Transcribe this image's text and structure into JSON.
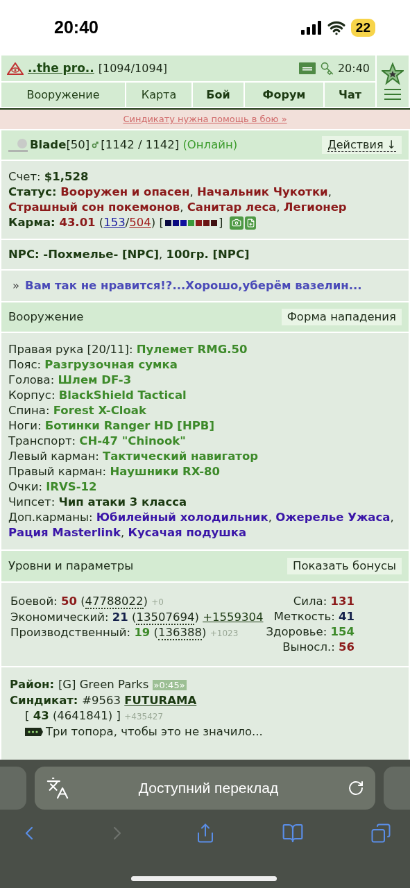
{
  "status_bar": {
    "time": "20:40",
    "battery": "22"
  },
  "header": {
    "nick": "..the pro..",
    "hp": "[1094/1094]",
    "time": "20:40"
  },
  "nav_tabs": [
    {
      "label": "Вооружение",
      "bold": false
    },
    {
      "label": "Карта",
      "bold": false
    },
    {
      "label": "Бой",
      "bold": true
    },
    {
      "label": "Форум",
      "bold": true
    },
    {
      "label": "Чат",
      "bold": true
    }
  ],
  "banner": "Синдикату нужна помощь в бою »",
  "player": {
    "name": [
      {
        "text": "Blade",
        "kind": "label"
      },
      {
        "text": "[50]",
        "kind": "plain"
      }
    ],
    "health": [
      {
        "text": "[1142 / 1142] ",
        "kind": "plain"
      },
      {
        "text": "(Онлайн)",
        "kind": "online"
      }
    ],
    "actions": "Действия ↓"
  },
  "info": [
    [
      {
        "text": "Счет: ",
        "kind": "plain"
      },
      {
        "text": "$1,528",
        "kind": "label"
      }
    ],
    [
      {
        "text": "Статус: ",
        "kind": "label"
      },
      {
        "text": "Вооружен и опасен",
        "kind": "red"
      },
      {
        "text": ", ",
        "kind": "plain"
      },
      {
        "text": "Начальник Чукотки",
        "kind": "red"
      },
      {
        "text": ", ",
        "kind": "plain"
      },
      {
        "text": "Страшный сон покемонов",
        "kind": "red"
      },
      {
        "text": ", ",
        "kind": "plain"
      },
      {
        "text": "Санитар леса",
        "kind": "red"
      },
      {
        "text": ", ",
        "kind": "plain"
      },
      {
        "text": "Легионер",
        "kind": "red"
      }
    ]
  ],
  "karma": {
    "text": [
      {
        "text": "Карма: ",
        "kind": "label"
      },
      {
        "text": "43.01",
        "kind": "red"
      },
      {
        "text": " (",
        "kind": "plain"
      },
      {
        "text": "153",
        "kind": "link-blue"
      },
      {
        "text": "/",
        "kind": "plain"
      },
      {
        "text": "504",
        "kind": "link-red"
      },
      {
        "text": ") [",
        "kind": "plain"
      }
    ],
    "squares": [
      {
        "color": "#0a0a40"
      },
      {
        "color": "#0a0a80"
      },
      {
        "color": "#1010a0"
      },
      {
        "color": "#3a9a3a"
      },
      {
        "color": "#8b1a1a"
      },
      {
        "color": "#6b1414"
      },
      {
        "color": "#401010"
      }
    ],
    "close": "]"
  },
  "npc": [
    {
      "text": "NPC: -Похмелье- [NPC]",
      "kind": "label"
    },
    {
      "text": ", ",
      "kind": "plain"
    },
    {
      "text": "100гр. [NPC]",
      "kind": "label"
    }
  ],
  "quote": {
    "mark": "»",
    "text": "Вам так не нравится!?...Хорошо,уберём вазелин..."
  },
  "equipment": {
    "title": "Вооружение",
    "button": "Форма нападения",
    "rows": [
      [
        {
          "text": "Правая рука [20/11]: ",
          "kind": "plain"
        },
        {
          "text": "Пулемет RMG.50",
          "kind": "green"
        }
      ],
      [
        {
          "text": "Пояс: ",
          "kind": "plain"
        },
        {
          "text": "Разгрузочная сумка",
          "kind": "green"
        }
      ],
      [
        {
          "text": "Голова: ",
          "kind": "plain"
        },
        {
          "text": "Шлем DF-3",
          "kind": "green"
        }
      ],
      [
        {
          "text": "Корпус: ",
          "kind": "plain"
        },
        {
          "text": "BlackShield Tactical",
          "kind": "green"
        }
      ],
      [
        {
          "text": "Спина: ",
          "kind": "plain"
        },
        {
          "text": "Forest X-Cloak",
          "kind": "green"
        }
      ],
      [
        {
          "text": "Ноги: ",
          "kind": "plain"
        },
        {
          "text": "Ботинки Ranger HD [HPB]",
          "kind": "green"
        }
      ],
      [
        {
          "text": "Транспорт: ",
          "kind": "plain"
        },
        {
          "text": "CH-47 \"Chinook\"",
          "kind": "green"
        }
      ],
      [
        {
          "text": "Левый карман: ",
          "kind": "plain"
        },
        {
          "text": "Тактический навигатор",
          "kind": "green"
        }
      ],
      [
        {
          "text": "Правый карман: ",
          "kind": "plain"
        },
        {
          "text": "Наушники RX-80",
          "kind": "green"
        }
      ],
      [
        {
          "text": "Очки: ",
          "kind": "plain"
        },
        {
          "text": "IRVS-12",
          "kind": "green"
        }
      ],
      [
        {
          "text": "Чипсет: ",
          "kind": "plain"
        },
        {
          "text": "Чип атаки 3 класса",
          "kind": "label"
        }
      ],
      [
        {
          "text": "Доп.карманы: ",
          "kind": "plain"
        },
        {
          "text": "Юбилейный холодильник",
          "kind": "purple"
        },
        {
          "text": ", ",
          "kind": "plain"
        },
        {
          "text": "Ожерелье Ужаса",
          "kind": "purple"
        },
        {
          "text": ", ",
          "kind": "plain"
        },
        {
          "text": "Рация Masterlink",
          "kind": "purple"
        },
        {
          "text": ", ",
          "kind": "plain"
        },
        {
          "text": "Кусачая подушка",
          "kind": "purple"
        }
      ]
    ]
  },
  "levels": {
    "title": "Уровни и параметры",
    "button": "Показать бонусы",
    "left": [
      [
        {
          "text": "Боевой: ",
          "kind": "plain"
        },
        {
          "text": "50",
          "kind": "red"
        },
        {
          "text": " (",
          "kind": "plain"
        },
        {
          "text": "47788022",
          "kind": "dotted"
        },
        {
          "text": ") ",
          "kind": "plain"
        },
        {
          "text": "+0",
          "kind": "small"
        }
      ],
      [
        {
          "text": "Экономический: ",
          "kind": "plain"
        },
        {
          "text": "21",
          "kind": "navy"
        },
        {
          "text": " (",
          "kind": "plain"
        },
        {
          "text": "13507694",
          "kind": "dotted"
        },
        {
          "text": ") ",
          "kind": "plain"
        },
        {
          "text": "+1559304",
          "kind": "link-plain"
        }
      ],
      [
        {
          "text": "Производственный: ",
          "kind": "plain"
        },
        {
          "text": "19",
          "kind": "green"
        },
        {
          "text": " (",
          "kind": "plain"
        },
        {
          "text": "136388",
          "kind": "dotted"
        },
        {
          "text": ") ",
          "kind": "plain"
        },
        {
          "text": "+1023",
          "kind": "small"
        }
      ]
    ],
    "right": [
      [
        {
          "text": "Сила: ",
          "kind": "plain"
        },
        {
          "text": "131",
          "kind": "red"
        }
      ],
      [
        {
          "text": "Меткость: ",
          "kind": "plain"
        },
        {
          "text": "41",
          "kind": "navy"
        }
      ],
      [
        {
          "text": "Здоровье: ",
          "kind": "plain"
        },
        {
          "text": "154",
          "kind": "green"
        }
      ],
      [
        {
          "text": "Выносл.: ",
          "kind": "plain"
        },
        {
          "text": "56",
          "kind": "red"
        }
      ]
    ]
  },
  "syndicate": [
    {
      "kind": "line",
      "segments": [
        {
          "text": "Район: ",
          "kind": "label"
        },
        {
          "text": "[G] Green Parks ",
          "kind": "plain"
        },
        {
          "text": "»0:45»",
          "kind": "badge"
        }
      ]
    },
    {
      "kind": "line",
      "segments": [
        {
          "text": "Синдикат: ",
          "kind": "label"
        },
        {
          "text": "#9563 ",
          "kind": "plain"
        },
        {
          "text": "FUTURAMA",
          "kind": "link-bold"
        }
      ]
    },
    {
      "kind": "subline",
      "segments": [
        {
          "text": "[ ",
          "kind": "plain"
        },
        {
          "text": "43",
          "kind": "label"
        },
        {
          "text": " (4641841) ] ",
          "kind": "plain"
        },
        {
          "text": "+435427",
          "kind": "small"
        }
      ]
    },
    {
      "kind": "rank",
      "segments": [
        {
          "text": "Три топора, чтобы это не значило...",
          "kind": "plain"
        }
      ]
    }
  ],
  "browser": {
    "address": "Доступний переклад",
    "toolbar": [
      {
        "kind": "back",
        "disabled": false
      },
      {
        "kind": "forward",
        "disabled": true
      },
      {
        "kind": "share",
        "disabled": false
      },
      {
        "kind": "bookmarks",
        "disabled": false
      },
      {
        "kind": "tabs",
        "disabled": false
      }
    ]
  }
}
